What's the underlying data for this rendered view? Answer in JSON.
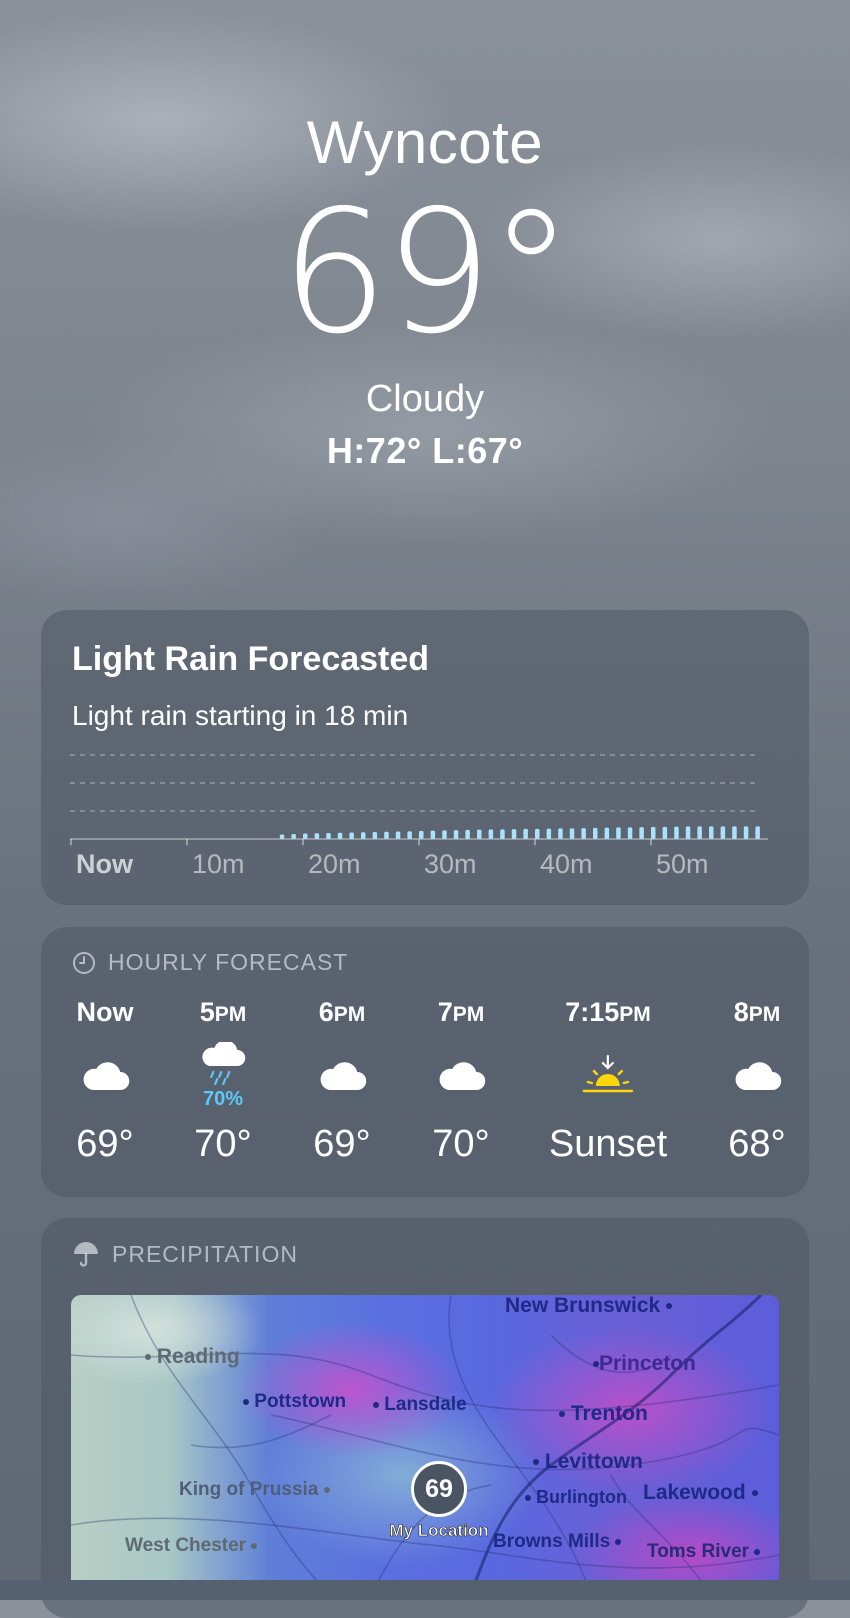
{
  "location": {
    "city": "Wyncote",
    "temperature": "69°",
    "condition": "Cloudy",
    "high_low": "H:72°  L:67°"
  },
  "rain_card": {
    "title": "Light Rain Forecasted",
    "subtitle": "Light rain starting in 18 min",
    "axis_labels": [
      "Now",
      "10m",
      "20m",
      "30m",
      "40m",
      "50m"
    ],
    "rain_start_minute": 18,
    "intensity_by_minute": [
      0,
      0,
      0,
      0,
      0,
      0,
      0,
      0,
      0,
      0,
      0,
      0,
      0,
      0,
      0,
      0,
      0,
      0,
      0.18,
      0.2,
      0.22,
      0.23,
      0.24,
      0.25,
      0.26,
      0.27,
      0.28,
      0.29,
      0.3,
      0.31,
      0.32,
      0.33,
      0.34,
      0.35,
      0.36,
      0.37,
      0.38,
      0.38,
      0.39,
      0.4,
      0.4,
      0.41,
      0.42,
      0.42,
      0.43,
      0.44,
      0.45,
      0.46,
      0.46,
      0.47,
      0.48,
      0.48,
      0.49,
      0.5,
      0.5,
      0.5,
      0.5,
      0.5,
      0.5,
      0.5
    ]
  },
  "hourly": {
    "heading": "HOURLY FORECAST",
    "items": [
      {
        "time": "Now",
        "suffix": "",
        "icon": "cloud-icon",
        "precip": "",
        "temp": "69°"
      },
      {
        "time": "5",
        "suffix": "PM",
        "icon": "cloud-rain-icon",
        "precip": "70%",
        "temp": "70°"
      },
      {
        "time": "6",
        "suffix": "PM",
        "icon": "cloud-icon",
        "precip": "",
        "temp": "69°"
      },
      {
        "time": "7",
        "suffix": "PM",
        "icon": "cloud-icon",
        "precip": "",
        "temp": "70°"
      },
      {
        "time": "7:15",
        "suffix": "PM",
        "icon": "sunset-icon",
        "precip": "",
        "temp": "Sunset"
      },
      {
        "time": "8",
        "suffix": "PM",
        "icon": "cloud-icon",
        "precip": "",
        "temp": "68°"
      }
    ]
  },
  "precipitation": {
    "heading": "PRECIPITATION",
    "map_labels": {
      "new_brunswick": "New Brunswick",
      "reading": "Reading",
      "princeton": "Princeton",
      "pottstown": "Pottstown",
      "lansdale": "Lansdale",
      "trenton": "Trenton",
      "levittown": "Levittown",
      "king_of_prussia": "King of Prussia",
      "burlington": "Burlington",
      "lakewood": "Lakewood",
      "west_chester": "West Chester",
      "browns_mills": "Browns Mills",
      "toms_river": "Toms River"
    },
    "my_location": {
      "temp": "69",
      "caption": "My Location"
    }
  },
  "colors": {
    "rain_bar": "#a9e2fb",
    "precip_text": "#5ac8fa",
    "sun": "#ffd60a",
    "card_bg": "rgba(78,88,101,0.55)"
  }
}
